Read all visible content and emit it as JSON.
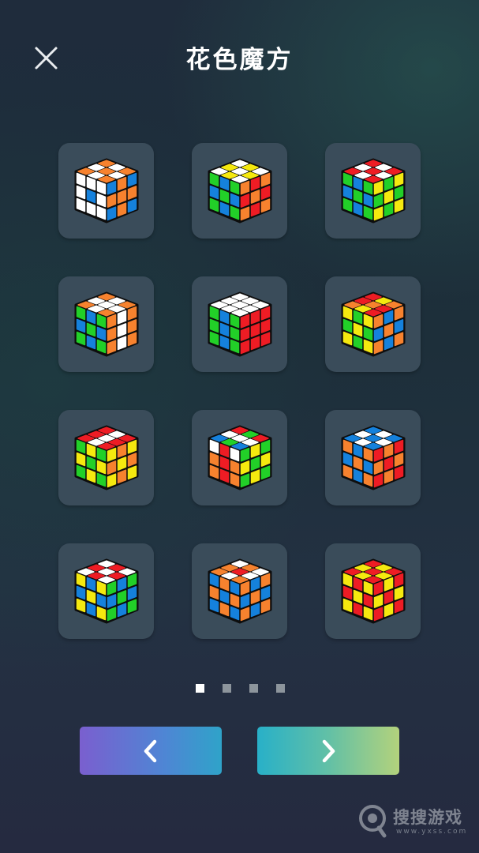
{
  "header": {
    "title": "花色魔方",
    "close_icon": "close-icon"
  },
  "colors": {
    "W": "#ffffff",
    "Y": "#f5e90f",
    "R": "#ee1c24",
    "O": "#f7822e",
    "G": "#22d028",
    "B": "#1581dc",
    "body": "#0d0d0d",
    "tile": "#3a4c5a"
  },
  "patterns": [
    {
      "name": "pattern-1",
      "top": "OWOWOWOWO",
      "left": "WWWWBWWWW",
      "right": "BOBOOOBOB"
    },
    {
      "name": "pattern-2",
      "top": "WYWYWYWYW",
      "left": "GBGBGBGBG",
      "right": "OROROROROR"
    },
    {
      "name": "pattern-3",
      "top": "RWRWRWRWR",
      "left": "GBGBGBGBG",
      "right": "YGYGYGYGY"
    },
    {
      "name": "pattern-4",
      "top": "OWOWWWOWO",
      "left": "GBGBGBGBG",
      "right": "OWOOWOOWO"
    },
    {
      "name": "pattern-5",
      "top": "WWWWWWWWW",
      "left": "GBGGBGGBG",
      "right": "RRRRRRRRR"
    },
    {
      "name": "pattern-6",
      "top": "RYOROROYR",
      "left": "YGYGYGYGY",
      "right": "OBOBOBOBO"
    },
    {
      "name": "pattern-7",
      "top": "RWRRWRRWR",
      "left": "GYGYGYGYG",
      "right": "YOYOYOYOY"
    },
    {
      "name": "pattern-8",
      "top": "RGRWWWBGB",
      "left": "WRWOROORO",
      "right": "GYGYGYGYG"
    },
    {
      "name": "pattern-9",
      "top": "BWBWBWBWB",
      "left": "OBOBOBOBO",
      "right": "ROROROROR"
    },
    {
      "name": "pattern-10",
      "top": "WRWRWRWRW",
      "left": "YBYBYBYBY",
      "right": "GBGBGBGBG"
    },
    {
      "name": "pattern-11",
      "top": "WOWORWOWO",
      "left": "BOBOBOBOB",
      "right": "OBOBOBOBO"
    },
    {
      "name": "pattern-12",
      "top": "RYRYRYRYR",
      "left": "YRYRYRYRY",
      "right": "RYRYRYRYR"
    }
  ],
  "pagination": {
    "pages": 4,
    "current": 1
  },
  "buttons": {
    "prev_icon": "chevron-left-icon",
    "next_icon": "chevron-right-icon"
  },
  "watermark": {
    "text": "搜搜游戏",
    "url": "www.yxss.com"
  }
}
